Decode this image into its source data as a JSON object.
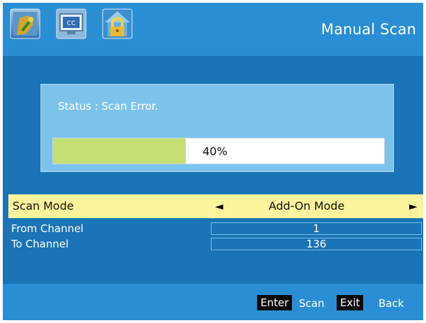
{
  "header": {
    "title": "Manual Scan",
    "icons": [
      {
        "name": "picture-icon"
      },
      {
        "name": "closed-caption-icon",
        "text": "CC"
      },
      {
        "name": "lock-icon"
      }
    ]
  },
  "status_panel": {
    "status_text": "Status : Scan Error.",
    "progress": {
      "percent": 40,
      "label": "40%"
    }
  },
  "scan_mode": {
    "label": "Scan Mode",
    "value": "Add-On Mode",
    "left_arrow": "◄",
    "right_arrow": "►"
  },
  "from_channel": {
    "label": "From Channel",
    "value": "1"
  },
  "to_channel": {
    "label": "To Channel",
    "value": "136"
  },
  "footer": {
    "enter_key": "Enter",
    "enter_action": "Scan",
    "exit_key": "Exit",
    "exit_action": "Back"
  },
  "colors": {
    "background": "#1a74b5",
    "header": "#2a8ed4",
    "panel": "#7cc3ec",
    "progress_fill": "#c4df74",
    "highlight_row": "#fbf49d"
  }
}
